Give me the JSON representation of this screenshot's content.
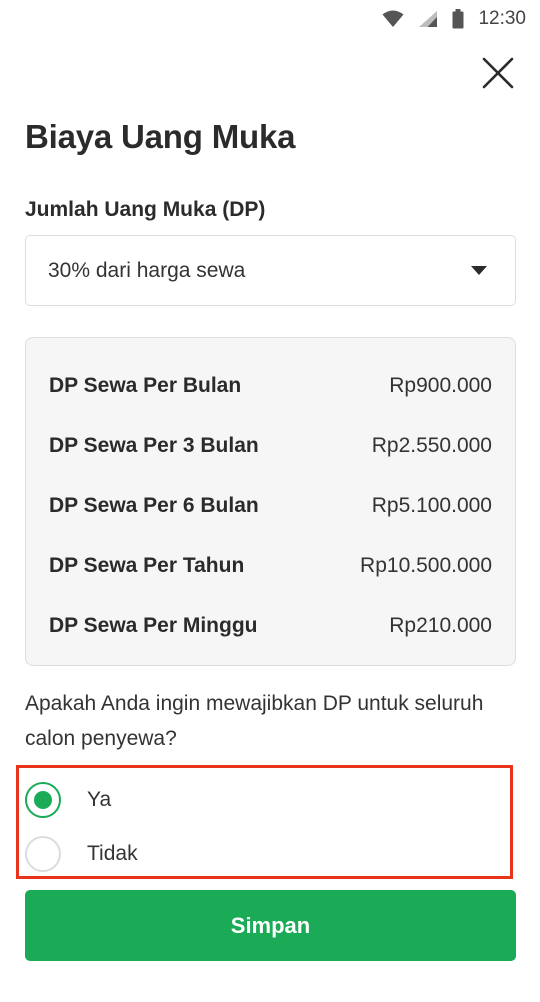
{
  "status_bar": {
    "time": "12:30",
    "icons": [
      "wifi-icon",
      "cellular-signal-icon",
      "battery-icon"
    ]
  },
  "header": {
    "close_icon": "close-icon",
    "title": "Biaya Uang Muka"
  },
  "down_payment": {
    "label": "Jumlah Uang Muka (DP)",
    "selected_value": "30% dari harga sewa"
  },
  "price_summary": {
    "rows": [
      {
        "label": "DP Sewa Per Bulan",
        "value": "Rp900.000"
      },
      {
        "label": "DP Sewa Per 3 Bulan",
        "value": "Rp2.550.000"
      },
      {
        "label": "DP Sewa Per 6 Bulan",
        "value": "Rp5.100.000"
      },
      {
        "label": "DP Sewa Per Tahun",
        "value": "Rp10.500.000"
      },
      {
        "label": "DP Sewa Per Minggu",
        "value": "Rp210.000"
      }
    ]
  },
  "requirement": {
    "question": "Apakah Anda ingin mewajibkan DP untuk seluruh calon penyewa?",
    "options": [
      {
        "label": "Ya",
        "checked": true
      },
      {
        "label": "Tidak",
        "checked": false
      }
    ],
    "highlight_color": "#e8341c"
  },
  "actions": {
    "save_label": "Simpan"
  },
  "colors": {
    "accent": "#1baa56",
    "text": "#2b2b2b",
    "border": "#dddddd",
    "summary_background": "#f6f6f6"
  }
}
